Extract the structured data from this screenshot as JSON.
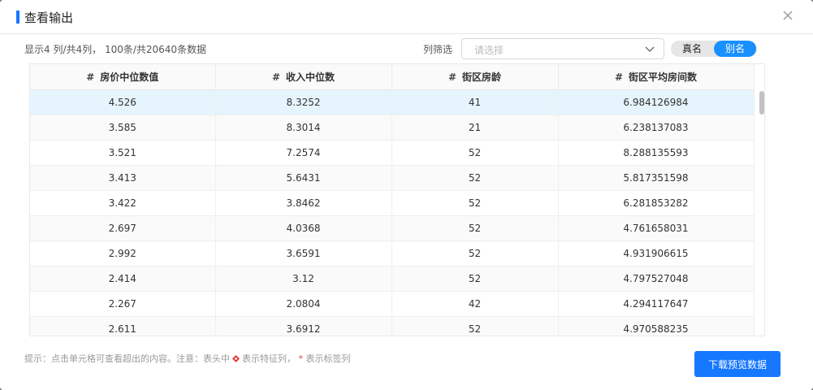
{
  "dialog": {
    "title": "查看输出"
  },
  "info": "显示4 列/共4列， 100条/共20640条数据",
  "filter": {
    "label": "列筛选",
    "placeholder": "请选择"
  },
  "toggle": {
    "real": "真名",
    "alias": "别名",
    "active": "别名"
  },
  "table": {
    "columns": [
      {
        "icon": "#",
        "label": "房价中位数值"
      },
      {
        "icon": "#",
        "label": "收入中位数"
      },
      {
        "icon": "#",
        "label": "街区房龄"
      },
      {
        "icon": "#",
        "label": "街区平均房间数"
      }
    ],
    "rows": [
      [
        "4.526",
        "8.3252",
        "41",
        "6.984126984"
      ],
      [
        "3.585",
        "8.3014",
        "21",
        "6.238137083"
      ],
      [
        "3.521",
        "7.2574",
        "52",
        "8.288135593"
      ],
      [
        "3.413",
        "5.6431",
        "52",
        "5.817351598"
      ],
      [
        "3.422",
        "3.8462",
        "52",
        "6.281853282"
      ],
      [
        "2.697",
        "4.0368",
        "52",
        "4.761658031"
      ],
      [
        "2.992",
        "3.6591",
        "52",
        "4.931906615"
      ],
      [
        "2.414",
        "3.12",
        "52",
        "4.797527048"
      ],
      [
        "2.267",
        "2.0804",
        "42",
        "4.294117647"
      ],
      [
        "2.611",
        "3.6912",
        "52",
        "4.970588235"
      ]
    ]
  },
  "hint": {
    "prefix": "提示：点击单元格可查看超出的内容。注意：表头中",
    "feature_text": "表示特征列，",
    "star": "*",
    "label_text": "表示标签列"
  },
  "download_button": "下载预览数据",
  "colors": {
    "primary": "#1677ff",
    "selected_row": "#e6f4fd",
    "toggle_active": "#1890ff",
    "star": "#e53935"
  }
}
